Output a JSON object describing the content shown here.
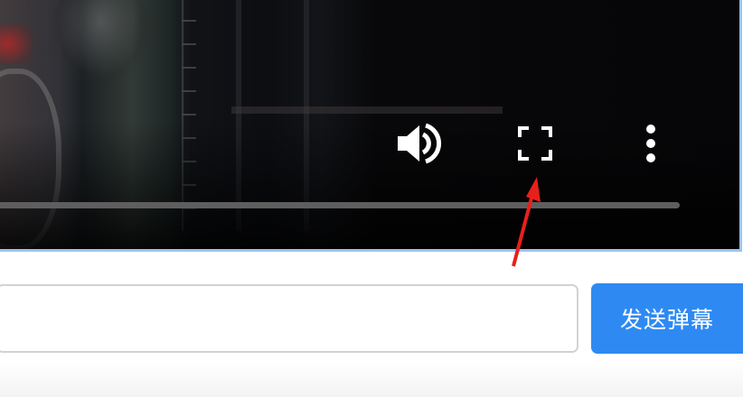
{
  "player": {
    "progress_fraction": 0,
    "controls": {
      "volume_icon": "volume-icon",
      "fullscreen_icon": "fullscreen-icon",
      "more_icon": "more-vertical-icon"
    }
  },
  "danmaku": {
    "input_value": "",
    "send_label": "发送弹幕"
  },
  "colors": {
    "accent": "#2e8af2",
    "annotation": "#e8201c",
    "player_border": "#9cc3ee"
  }
}
